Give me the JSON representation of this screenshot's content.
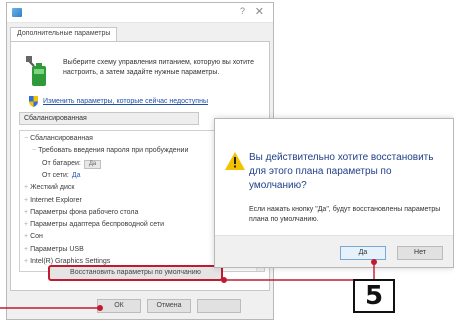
{
  "main_window": {
    "title": "",
    "help_glyph": "?",
    "close_glyph": "✕",
    "tab": "Дополнительные параметры",
    "intro": "Выберите схему управления питанием, которую вы хотите настроить, а затем задайте нужные параметры.",
    "change_link": "Изменить параметры, которые сейчас недоступны",
    "scheme_selected": "Сбалансированная",
    "tree": [
      {
        "text": "Сбалансированная",
        "indent": 0,
        "expander": "−"
      },
      {
        "text": "Требовать введения пароля при пробуждении",
        "indent": 1,
        "expander": "−"
      },
      {
        "text": "От батареи:",
        "indent": 2,
        "expander": "",
        "combo": "Да"
      },
      {
        "text": "От сети:",
        "indent": 2,
        "expander": "",
        "link_value": "Да"
      },
      {
        "text": "Жесткий диск",
        "indent": 0,
        "expander": "+"
      },
      {
        "text": "Internet Explorer",
        "indent": 0,
        "expander": "+"
      },
      {
        "text": "Параметры фона рабочего стола",
        "indent": 0,
        "expander": "+"
      },
      {
        "text": "Параметры адаптера беспроводной сети",
        "indent": 0,
        "expander": "+"
      },
      {
        "text": "Сон",
        "indent": 0,
        "expander": "+"
      },
      {
        "text": "Параметры USB",
        "indent": 0,
        "expander": "+"
      },
      {
        "text": "Intel(R) Graphics Settings",
        "indent": 0,
        "expander": "+"
      }
    ],
    "restore_button": "Восстановить параметры по умолчанию",
    "ok_button": "ОК",
    "cancel_button": "Отмена",
    "apply_button": ""
  },
  "confirm_dialog": {
    "title": "",
    "question": "Вы действительно хотите восстановить для этого плана параметры по умолчанию?",
    "detail": "Если нажать кнопку \"Да\", будут восстановлены параметры плана по умолчанию.",
    "yes_button": "Да",
    "no_button": "Нет"
  },
  "annotations": {
    "step_number": "5",
    "callout_color": "#c21a30"
  },
  "colors": {
    "link": "#1f4fa8",
    "question": "#1f3f8a",
    "warning": "#f2c200"
  }
}
